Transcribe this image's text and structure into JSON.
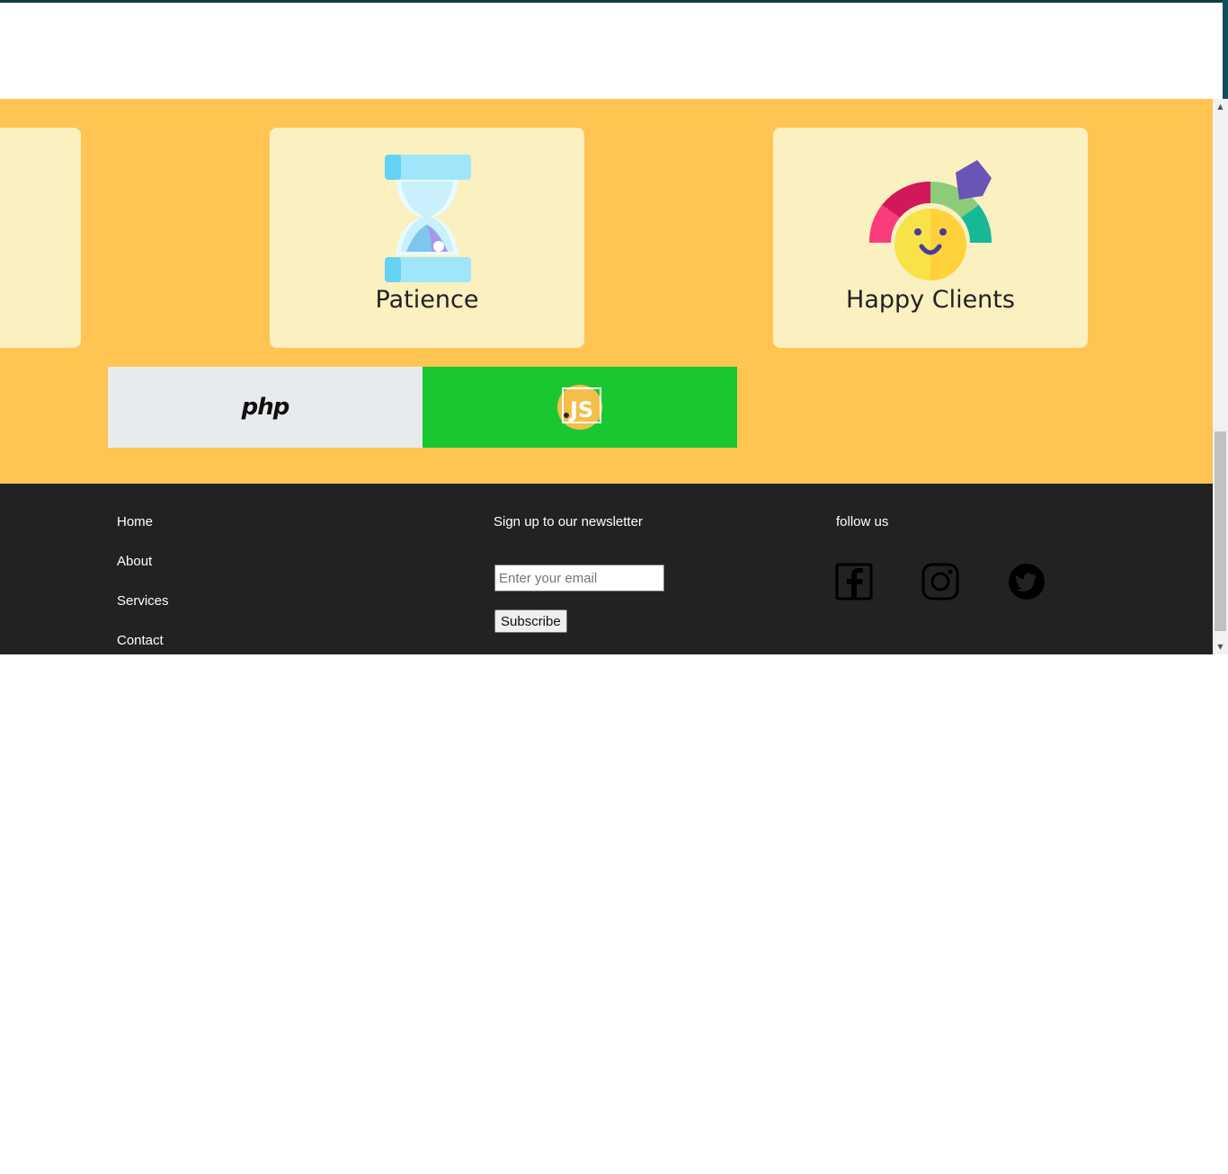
{
  "cards": [
    {
      "title": "",
      "icon": "partial-card"
    },
    {
      "title": "Patience",
      "icon": "hourglass-icon"
    },
    {
      "title": "Happy Clients",
      "icon": "happy-gauge-icon"
    }
  ],
  "logos": {
    "php": {
      "text": "php",
      "bg": "#e8ebee"
    },
    "js": {
      "text": "JS",
      "bg": "#19c830"
    }
  },
  "footer": {
    "nav": [
      "Home",
      "About",
      "Services",
      "Contact"
    ],
    "newsletter": {
      "title": "Sign up to our newsletter",
      "email_placeholder": "Enter your email",
      "email_value": "",
      "subscribe_label": "Subscribe"
    },
    "follow": {
      "title": "follow us",
      "icons": [
        "facebook-icon",
        "instagram-icon",
        "twitter-icon"
      ]
    }
  },
  "colors": {
    "section_bg": "#ffc452",
    "card_bg": "#faf0c0",
    "footer_bg": "#222222",
    "accent_top": "#0d3b45"
  }
}
